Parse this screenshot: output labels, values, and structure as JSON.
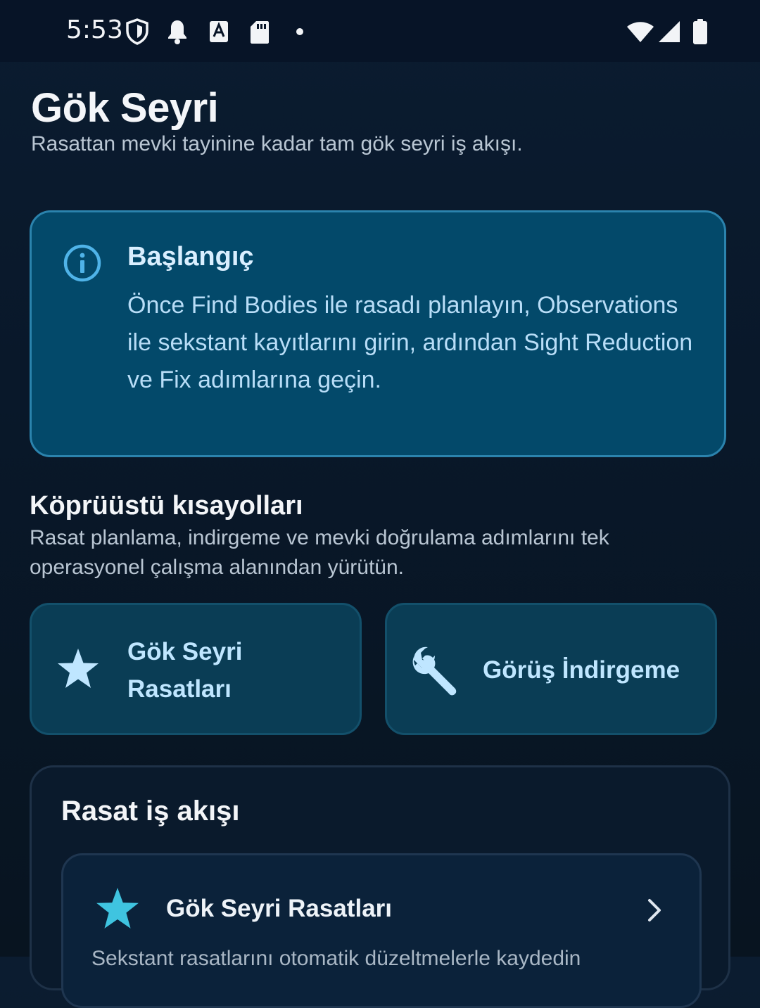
{
  "status_bar": {
    "time": "5:53",
    "icons": [
      "shield-icon",
      "bell-icon",
      "keyboard-a-icon",
      "sd-card-icon",
      "dot-icon",
      "wifi-icon",
      "signal-icon",
      "battery-icon"
    ]
  },
  "header": {
    "title": "Gök Seyri",
    "subtitle": "Rasattan mevki tayinine kadar tam gök seyri iş akışı."
  },
  "info_card": {
    "icon": "info-icon",
    "title": "Başlangıç",
    "body": "Önce Find Bodies ile rasadı planlayın, Observations ile sekstant kayıtlarını girin, ardından Sight Reduction ve Fix adımlarına geçin."
  },
  "shortcuts_section": {
    "title": "Köprüüstü kısayolları",
    "subtitle": "Rasat planlama, indirgeme ve mevki doğrulama adımlarını tek operasyonel çalışma alanından yürütün.",
    "items": [
      {
        "icon": "star-icon",
        "label_line1": "Gök Seyri",
        "label_line2": "Rasatları"
      },
      {
        "icon": "wrench-icon",
        "label": "Görüş İndirgeme"
      }
    ]
  },
  "workflow": {
    "title": "Rasat iş akışı",
    "items": [
      {
        "icon": "star-icon",
        "label": "Gök Seyri Rasatları",
        "description": "Sekstant rasatlarını otomatik düzeltmelerle kaydedin"
      }
    ]
  },
  "colors": {
    "background": "#0b1c30",
    "status_bar": "#071427",
    "info_card_bg": "#03496a",
    "info_card_border": "#2b83ad",
    "info_accent": "#4fb3e8",
    "shortcut_bg": "#0a3d55",
    "shortcut_text": "#bfe6ff",
    "star_accent": "#3fc4e0"
  }
}
